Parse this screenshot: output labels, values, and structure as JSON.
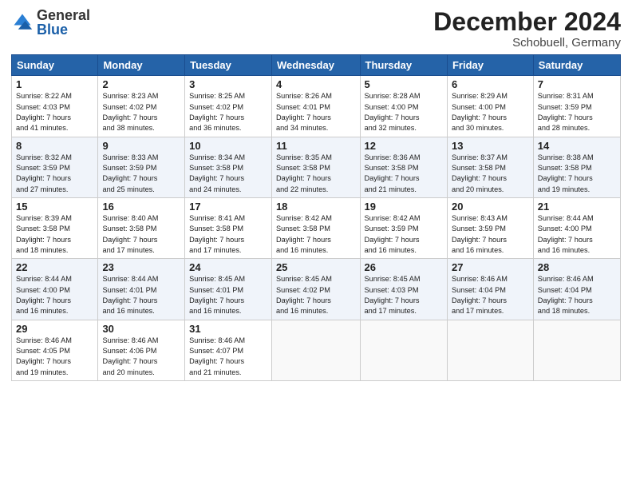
{
  "logo": {
    "general": "General",
    "blue": "Blue"
  },
  "header": {
    "month": "December 2024",
    "location": "Schobuell, Germany"
  },
  "weekdays": [
    "Sunday",
    "Monday",
    "Tuesday",
    "Wednesday",
    "Thursday",
    "Friday",
    "Saturday"
  ],
  "weeks": [
    [
      {
        "day": "1",
        "lines": [
          "Sunrise: 8:22 AM",
          "Sunset: 4:03 PM",
          "Daylight: 7 hours",
          "and 41 minutes."
        ]
      },
      {
        "day": "2",
        "lines": [
          "Sunrise: 8:23 AM",
          "Sunset: 4:02 PM",
          "Daylight: 7 hours",
          "and 38 minutes."
        ]
      },
      {
        "day": "3",
        "lines": [
          "Sunrise: 8:25 AM",
          "Sunset: 4:02 PM",
          "Daylight: 7 hours",
          "and 36 minutes."
        ]
      },
      {
        "day": "4",
        "lines": [
          "Sunrise: 8:26 AM",
          "Sunset: 4:01 PM",
          "Daylight: 7 hours",
          "and 34 minutes."
        ]
      },
      {
        "day": "5",
        "lines": [
          "Sunrise: 8:28 AM",
          "Sunset: 4:00 PM",
          "Daylight: 7 hours",
          "and 32 minutes."
        ]
      },
      {
        "day": "6",
        "lines": [
          "Sunrise: 8:29 AM",
          "Sunset: 4:00 PM",
          "Daylight: 7 hours",
          "and 30 minutes."
        ]
      },
      {
        "day": "7",
        "lines": [
          "Sunrise: 8:31 AM",
          "Sunset: 3:59 PM",
          "Daylight: 7 hours",
          "and 28 minutes."
        ]
      }
    ],
    [
      {
        "day": "8",
        "lines": [
          "Sunrise: 8:32 AM",
          "Sunset: 3:59 PM",
          "Daylight: 7 hours",
          "and 27 minutes."
        ]
      },
      {
        "day": "9",
        "lines": [
          "Sunrise: 8:33 AM",
          "Sunset: 3:59 PM",
          "Daylight: 7 hours",
          "and 25 minutes."
        ]
      },
      {
        "day": "10",
        "lines": [
          "Sunrise: 8:34 AM",
          "Sunset: 3:58 PM",
          "Daylight: 7 hours",
          "and 24 minutes."
        ]
      },
      {
        "day": "11",
        "lines": [
          "Sunrise: 8:35 AM",
          "Sunset: 3:58 PM",
          "Daylight: 7 hours",
          "and 22 minutes."
        ]
      },
      {
        "day": "12",
        "lines": [
          "Sunrise: 8:36 AM",
          "Sunset: 3:58 PM",
          "Daylight: 7 hours",
          "and 21 minutes."
        ]
      },
      {
        "day": "13",
        "lines": [
          "Sunrise: 8:37 AM",
          "Sunset: 3:58 PM",
          "Daylight: 7 hours",
          "and 20 minutes."
        ]
      },
      {
        "day": "14",
        "lines": [
          "Sunrise: 8:38 AM",
          "Sunset: 3:58 PM",
          "Daylight: 7 hours",
          "and 19 minutes."
        ]
      }
    ],
    [
      {
        "day": "15",
        "lines": [
          "Sunrise: 8:39 AM",
          "Sunset: 3:58 PM",
          "Daylight: 7 hours",
          "and 18 minutes."
        ]
      },
      {
        "day": "16",
        "lines": [
          "Sunrise: 8:40 AM",
          "Sunset: 3:58 PM",
          "Daylight: 7 hours",
          "and 17 minutes."
        ]
      },
      {
        "day": "17",
        "lines": [
          "Sunrise: 8:41 AM",
          "Sunset: 3:58 PM",
          "Daylight: 7 hours",
          "and 17 minutes."
        ]
      },
      {
        "day": "18",
        "lines": [
          "Sunrise: 8:42 AM",
          "Sunset: 3:58 PM",
          "Daylight: 7 hours",
          "and 16 minutes."
        ]
      },
      {
        "day": "19",
        "lines": [
          "Sunrise: 8:42 AM",
          "Sunset: 3:59 PM",
          "Daylight: 7 hours",
          "and 16 minutes."
        ]
      },
      {
        "day": "20",
        "lines": [
          "Sunrise: 8:43 AM",
          "Sunset: 3:59 PM",
          "Daylight: 7 hours",
          "and 16 minutes."
        ]
      },
      {
        "day": "21",
        "lines": [
          "Sunrise: 8:44 AM",
          "Sunset: 4:00 PM",
          "Daylight: 7 hours",
          "and 16 minutes."
        ]
      }
    ],
    [
      {
        "day": "22",
        "lines": [
          "Sunrise: 8:44 AM",
          "Sunset: 4:00 PM",
          "Daylight: 7 hours",
          "and 16 minutes."
        ]
      },
      {
        "day": "23",
        "lines": [
          "Sunrise: 8:44 AM",
          "Sunset: 4:01 PM",
          "Daylight: 7 hours",
          "and 16 minutes."
        ]
      },
      {
        "day": "24",
        "lines": [
          "Sunrise: 8:45 AM",
          "Sunset: 4:01 PM",
          "Daylight: 7 hours",
          "and 16 minutes."
        ]
      },
      {
        "day": "25",
        "lines": [
          "Sunrise: 8:45 AM",
          "Sunset: 4:02 PM",
          "Daylight: 7 hours",
          "and 16 minutes."
        ]
      },
      {
        "day": "26",
        "lines": [
          "Sunrise: 8:45 AM",
          "Sunset: 4:03 PM",
          "Daylight: 7 hours",
          "and 17 minutes."
        ]
      },
      {
        "day": "27",
        "lines": [
          "Sunrise: 8:46 AM",
          "Sunset: 4:04 PM",
          "Daylight: 7 hours",
          "and 17 minutes."
        ]
      },
      {
        "day": "28",
        "lines": [
          "Sunrise: 8:46 AM",
          "Sunset: 4:04 PM",
          "Daylight: 7 hours",
          "and 18 minutes."
        ]
      }
    ],
    [
      {
        "day": "29",
        "lines": [
          "Sunrise: 8:46 AM",
          "Sunset: 4:05 PM",
          "Daylight: 7 hours",
          "and 19 minutes."
        ]
      },
      {
        "day": "30",
        "lines": [
          "Sunrise: 8:46 AM",
          "Sunset: 4:06 PM",
          "Daylight: 7 hours",
          "and 20 minutes."
        ]
      },
      {
        "day": "31",
        "lines": [
          "Sunrise: 8:46 AM",
          "Sunset: 4:07 PM",
          "Daylight: 7 hours",
          "and 21 minutes."
        ]
      },
      {
        "day": "",
        "lines": []
      },
      {
        "day": "",
        "lines": []
      },
      {
        "day": "",
        "lines": []
      },
      {
        "day": "",
        "lines": []
      }
    ]
  ]
}
